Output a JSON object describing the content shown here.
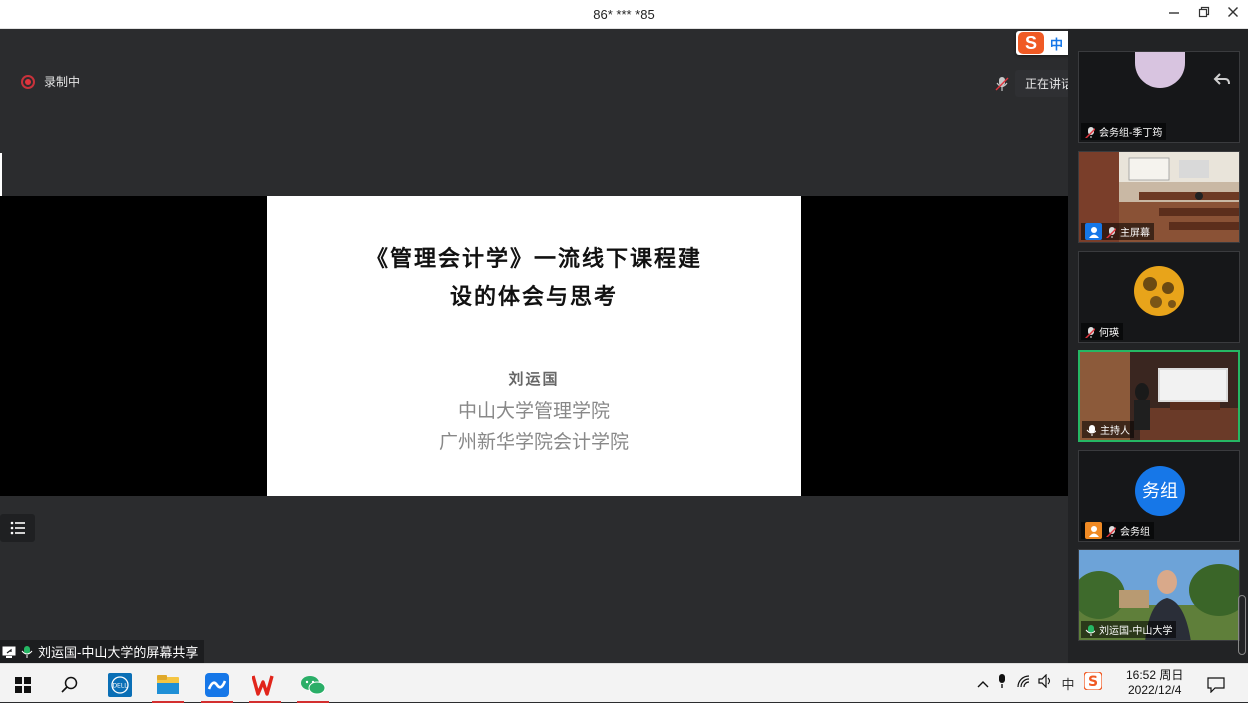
{
  "window": {
    "title": "86* *** *85"
  },
  "recording": {
    "label": "录制中"
  },
  "speaking": {
    "label": "正在讲话: 主持人; 刘运国-..."
  },
  "slide": {
    "title_line1": "《管理会计学》一流线下课程建",
    "title_line2": "设的体会与思考",
    "author": "刘运国",
    "inst1": "中山大学管理学院",
    "inst2": "广州新华学院会计学院"
  },
  "ime": {
    "lang": "中",
    "punct": "°,"
  },
  "participants": [
    {
      "name": "会务组-季丁筠"
    },
    {
      "name": "主屏幕"
    },
    {
      "name": "何瑛"
    },
    {
      "name": "主持人"
    },
    {
      "name": "会务组",
      "avatar_text": "务组"
    },
    {
      "name": "刘运国-中山大学"
    }
  ],
  "share_bar": {
    "label": "刘运国-中山大学的屏幕共享"
  },
  "taskbar": {
    "time": "16:52 周日",
    "date": "2022/12/4",
    "ime_indicator": "中"
  },
  "colors": {
    "active_border": "#25b864",
    "record_red": "#e0343d",
    "accent_blue": "#1677e8"
  }
}
